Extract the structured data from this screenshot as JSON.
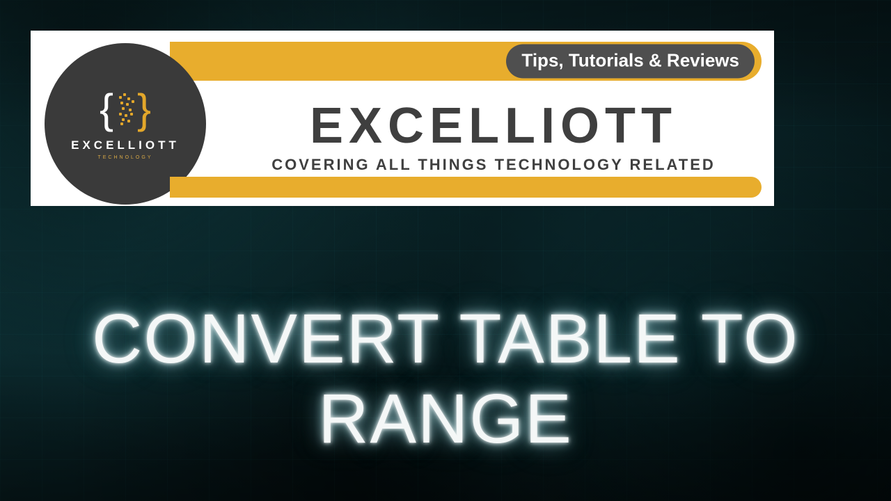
{
  "colors": {
    "accent_yellow": "#e8ad2d",
    "badge_dark": "#3a3a3a",
    "pill_grey": "#4f4f4f",
    "text_dark": "#3f3f3f",
    "glow_text": "#f4f7f7",
    "bg_base": "#0a2a2e"
  },
  "header": {
    "logo": {
      "brace_left": "{",
      "brace_right": "}",
      "name": "EXCELLIOTT",
      "subtext": "TECHNOLOGY",
      "icon_name": "braces-pixel-icon"
    },
    "pill_label": "Tips, Tutorials & Reviews",
    "brand_title": "EXCELLIOTT",
    "brand_subtitle": "COVERING ALL THINGS TECHNOLOGY RELATED"
  },
  "headline": "CONVERT TABLE TO RANGE"
}
